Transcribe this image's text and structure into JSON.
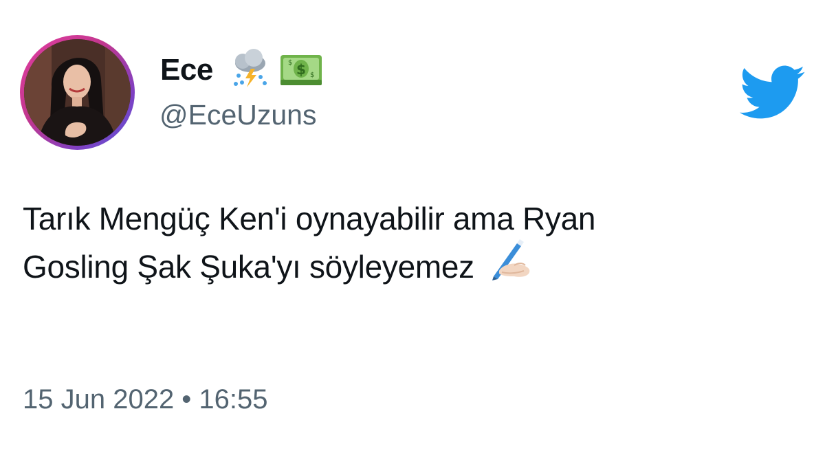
{
  "user": {
    "display_name": "Ece",
    "handle": "@EceUzuns",
    "name_emojis": [
      "cloud-rain-lightning-emoji",
      "dollar-banknote-emoji"
    ],
    "avatar": "avatar"
  },
  "tweet": {
    "line1": "Tarık Mengüç Ken'i oynayabilir ama Ryan",
    "line2": "Gosling Şak Şuka'yı söyleyemez",
    "emoji": "writing-hand-emoji"
  },
  "meta": {
    "timestamp": "15 Jun 2022 • 16:55"
  },
  "brand": {
    "logo": "twitter-bird-icon",
    "color": "#1d9bf0"
  }
}
